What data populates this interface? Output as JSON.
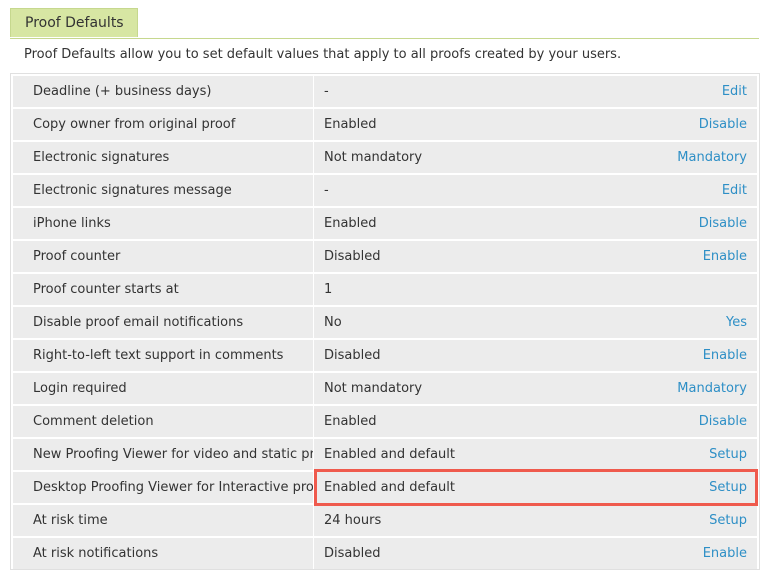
{
  "tab": {
    "label": "Proof Defaults"
  },
  "description": "Proof Defaults allow you to set default values that apply to all proofs created by your users.",
  "rows": [
    {
      "label": "Deadline (+ business days)",
      "value": "-",
      "action": "Edit"
    },
    {
      "label": "Copy owner from original proof",
      "value": "Enabled",
      "action": "Disable"
    },
    {
      "label": "Electronic signatures",
      "value": "Not mandatory",
      "action": "Mandatory"
    },
    {
      "label": "Electronic signatures message",
      "value": "-",
      "action": "Edit"
    },
    {
      "label": "iPhone links",
      "value": "Enabled",
      "action": "Disable"
    },
    {
      "label": "Proof counter",
      "value": "Disabled",
      "action": "Enable"
    },
    {
      "label": "Proof counter starts at",
      "value": "1",
      "action": ""
    },
    {
      "label": "Disable proof email notifications",
      "value": "No",
      "action": "Yes"
    },
    {
      "label": "Right-to-left text support in comments",
      "value": "Disabled",
      "action": "Enable"
    },
    {
      "label": "Login required",
      "value": "Not mandatory",
      "action": "Mandatory"
    },
    {
      "label": "Comment deletion",
      "value": "Enabled",
      "action": "Disable"
    },
    {
      "label": "New Proofing Viewer for video and static proofs",
      "value": "Enabled and default",
      "action": "Setup"
    },
    {
      "label": "Desktop Proofing Viewer for Interactive proofing",
      "value": "Enabled and default",
      "action": "Setup"
    },
    {
      "label": "At risk time",
      "value": "24 hours",
      "action": "Setup"
    },
    {
      "label": "At risk notifications",
      "value": "Disabled",
      "action": "Enable"
    }
  ],
  "colors": {
    "tab_bg": "#d7e6a3",
    "link": "#2e8fc6",
    "row_bg": "#ececec",
    "highlight": "#ef5a4d"
  }
}
